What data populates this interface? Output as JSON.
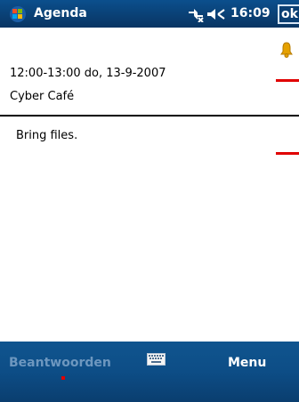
{
  "app": {
    "title": "Agenda",
    "time": "16:09",
    "ok_label": "ok"
  },
  "appointment": {
    "time_line": "12:00-13:00 do, 13-9-2007",
    "location": "Cyber Café",
    "notes": "Bring files."
  },
  "bottom_bar": {
    "left_softkey": "Beantwoorden",
    "right_softkey": "Menu"
  },
  "icons": {
    "start": "windows-flag-icon",
    "connectivity": "connectivity-icon",
    "volume": "speaker-icon",
    "reminder": "bell-icon",
    "keyboard": "keyboard-icon"
  },
  "colors": {
    "title_bar": "#0a3f73",
    "bottom_bar": "#0d4d86",
    "bell": "#e5a100",
    "marker": "#e00000",
    "softkey_disabled": "#6d97bf"
  }
}
